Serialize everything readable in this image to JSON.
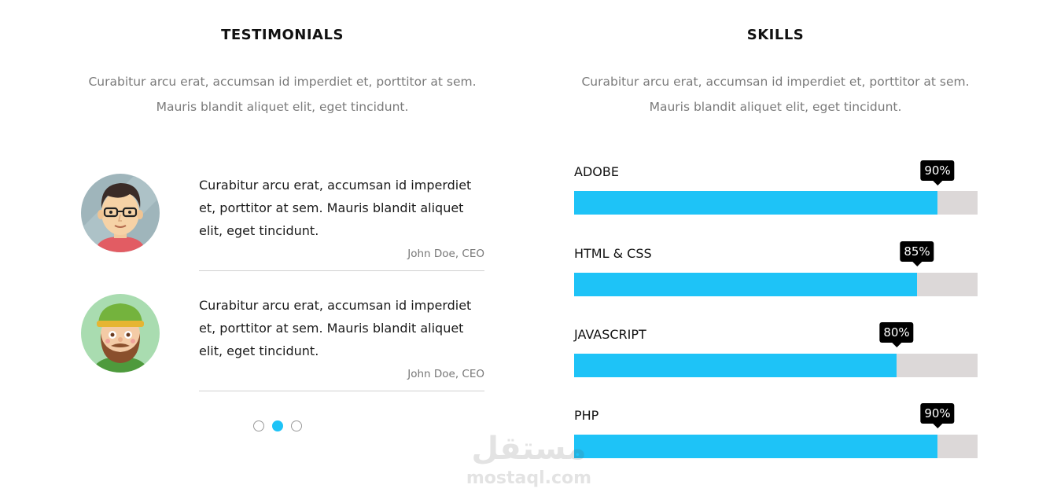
{
  "testimonials": {
    "title": "TESTIMONIALS",
    "intro_line1": "Curabitur arcu erat, accumsan id imperdiet et, porttitor at sem.",
    "intro_line2": "Mauris blandit aliquet elit, eget tincidunt.",
    "items": [
      {
        "text": "Curabitur arcu erat, accumsan id imperdiet et, porttitor at sem. Mauris blandit aliquet elit, eget tincidunt.",
        "author": "John Doe, CEO",
        "avatar_icon": "man-with-glasses-avatar-icon"
      },
      {
        "text": "Curabitur arcu erat, accumsan id imperdiet et, porttitor at sem. Mauris blandit aliquet elit, eget tincidunt.",
        "author": "John Doe, CEO",
        "avatar_icon": "bearded-man-with-cap-avatar-icon"
      }
    ],
    "pagination": {
      "count": 3,
      "active_index": 1
    }
  },
  "skills": {
    "title": "SKILLS",
    "intro_line1": "Curabitur arcu erat, accumsan id imperdiet et, porttitor at sem.",
    "intro_line2": "Mauris blandit aliquet elit, eget tincidunt.",
    "items": [
      {
        "label": "ADOBE",
        "percent_text": "90%",
        "value": 90
      },
      {
        "label": "HTML & CSS",
        "percent_text": "85%",
        "value": 85
      },
      {
        "label": "JAVASCRIPT",
        "percent_text": "80%",
        "value": 80
      },
      {
        "label": "PHP",
        "percent_text": "90%",
        "value": 90
      }
    ]
  },
  "watermark": {
    "arabic": "مستقل",
    "latin": "mostaql.com"
  },
  "colors": {
    "accent": "#1ec3f7",
    "track": "#dcd8d8",
    "tooltip": "#000000",
    "muted_text": "#7a7a7a"
  }
}
